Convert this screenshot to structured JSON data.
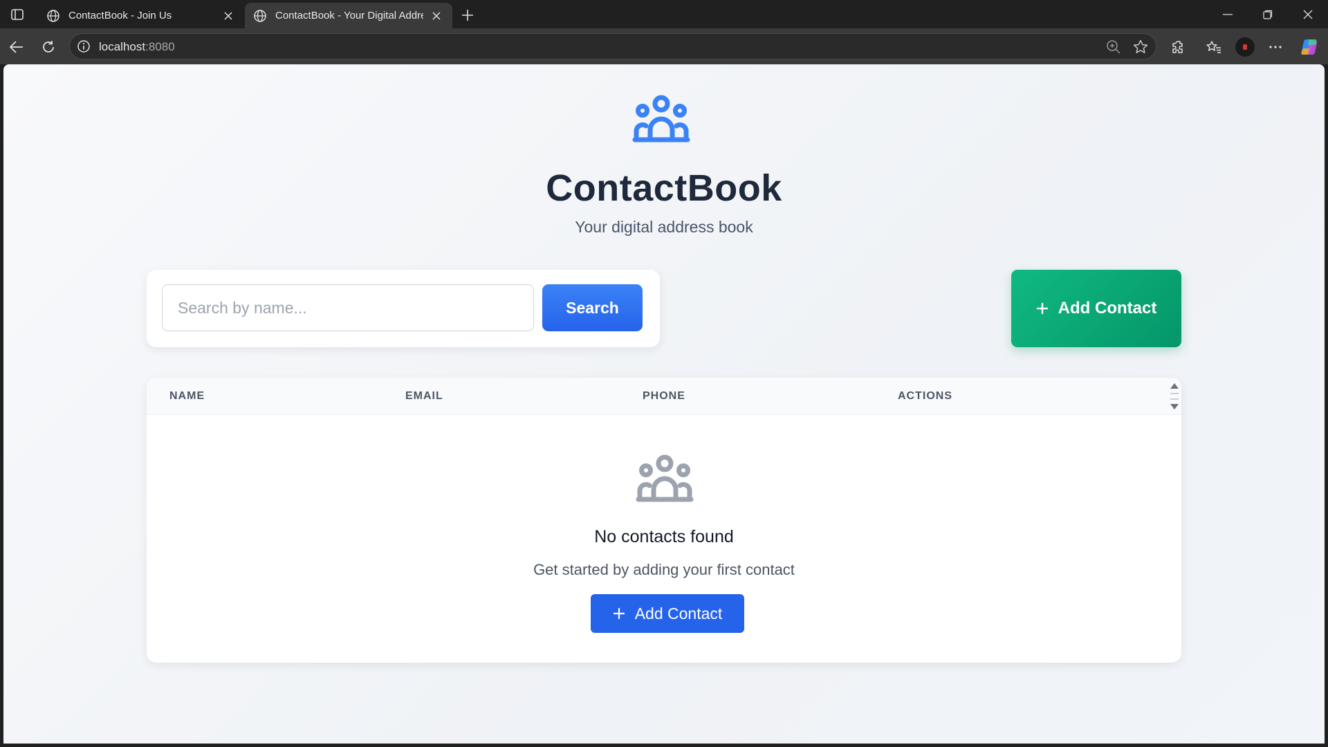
{
  "browser": {
    "tabs": [
      {
        "title": "ContactBook - Join Us",
        "active": false
      },
      {
        "title": "ContactBook - Your Digital Addre",
        "active": true
      }
    ],
    "url_host": "localhost",
    "url_port": ":8080"
  },
  "app": {
    "title": "ContactBook",
    "subtitle": "Your digital address book",
    "accent": "#3b82f6",
    "success": "#10b981"
  },
  "search": {
    "placeholder": "Search by name...",
    "value": "",
    "button_label": "Search"
  },
  "toolbar": {
    "add_label": "Add Contact"
  },
  "table": {
    "columns": [
      "NAME",
      "EMAIL",
      "PHONE",
      "ACTIONS"
    ],
    "rows": []
  },
  "empty_state": {
    "icon": "users-group-icon",
    "title": "No contacts found",
    "subtitle": "Get started by adding your first contact",
    "button_label": "Add Contact"
  }
}
